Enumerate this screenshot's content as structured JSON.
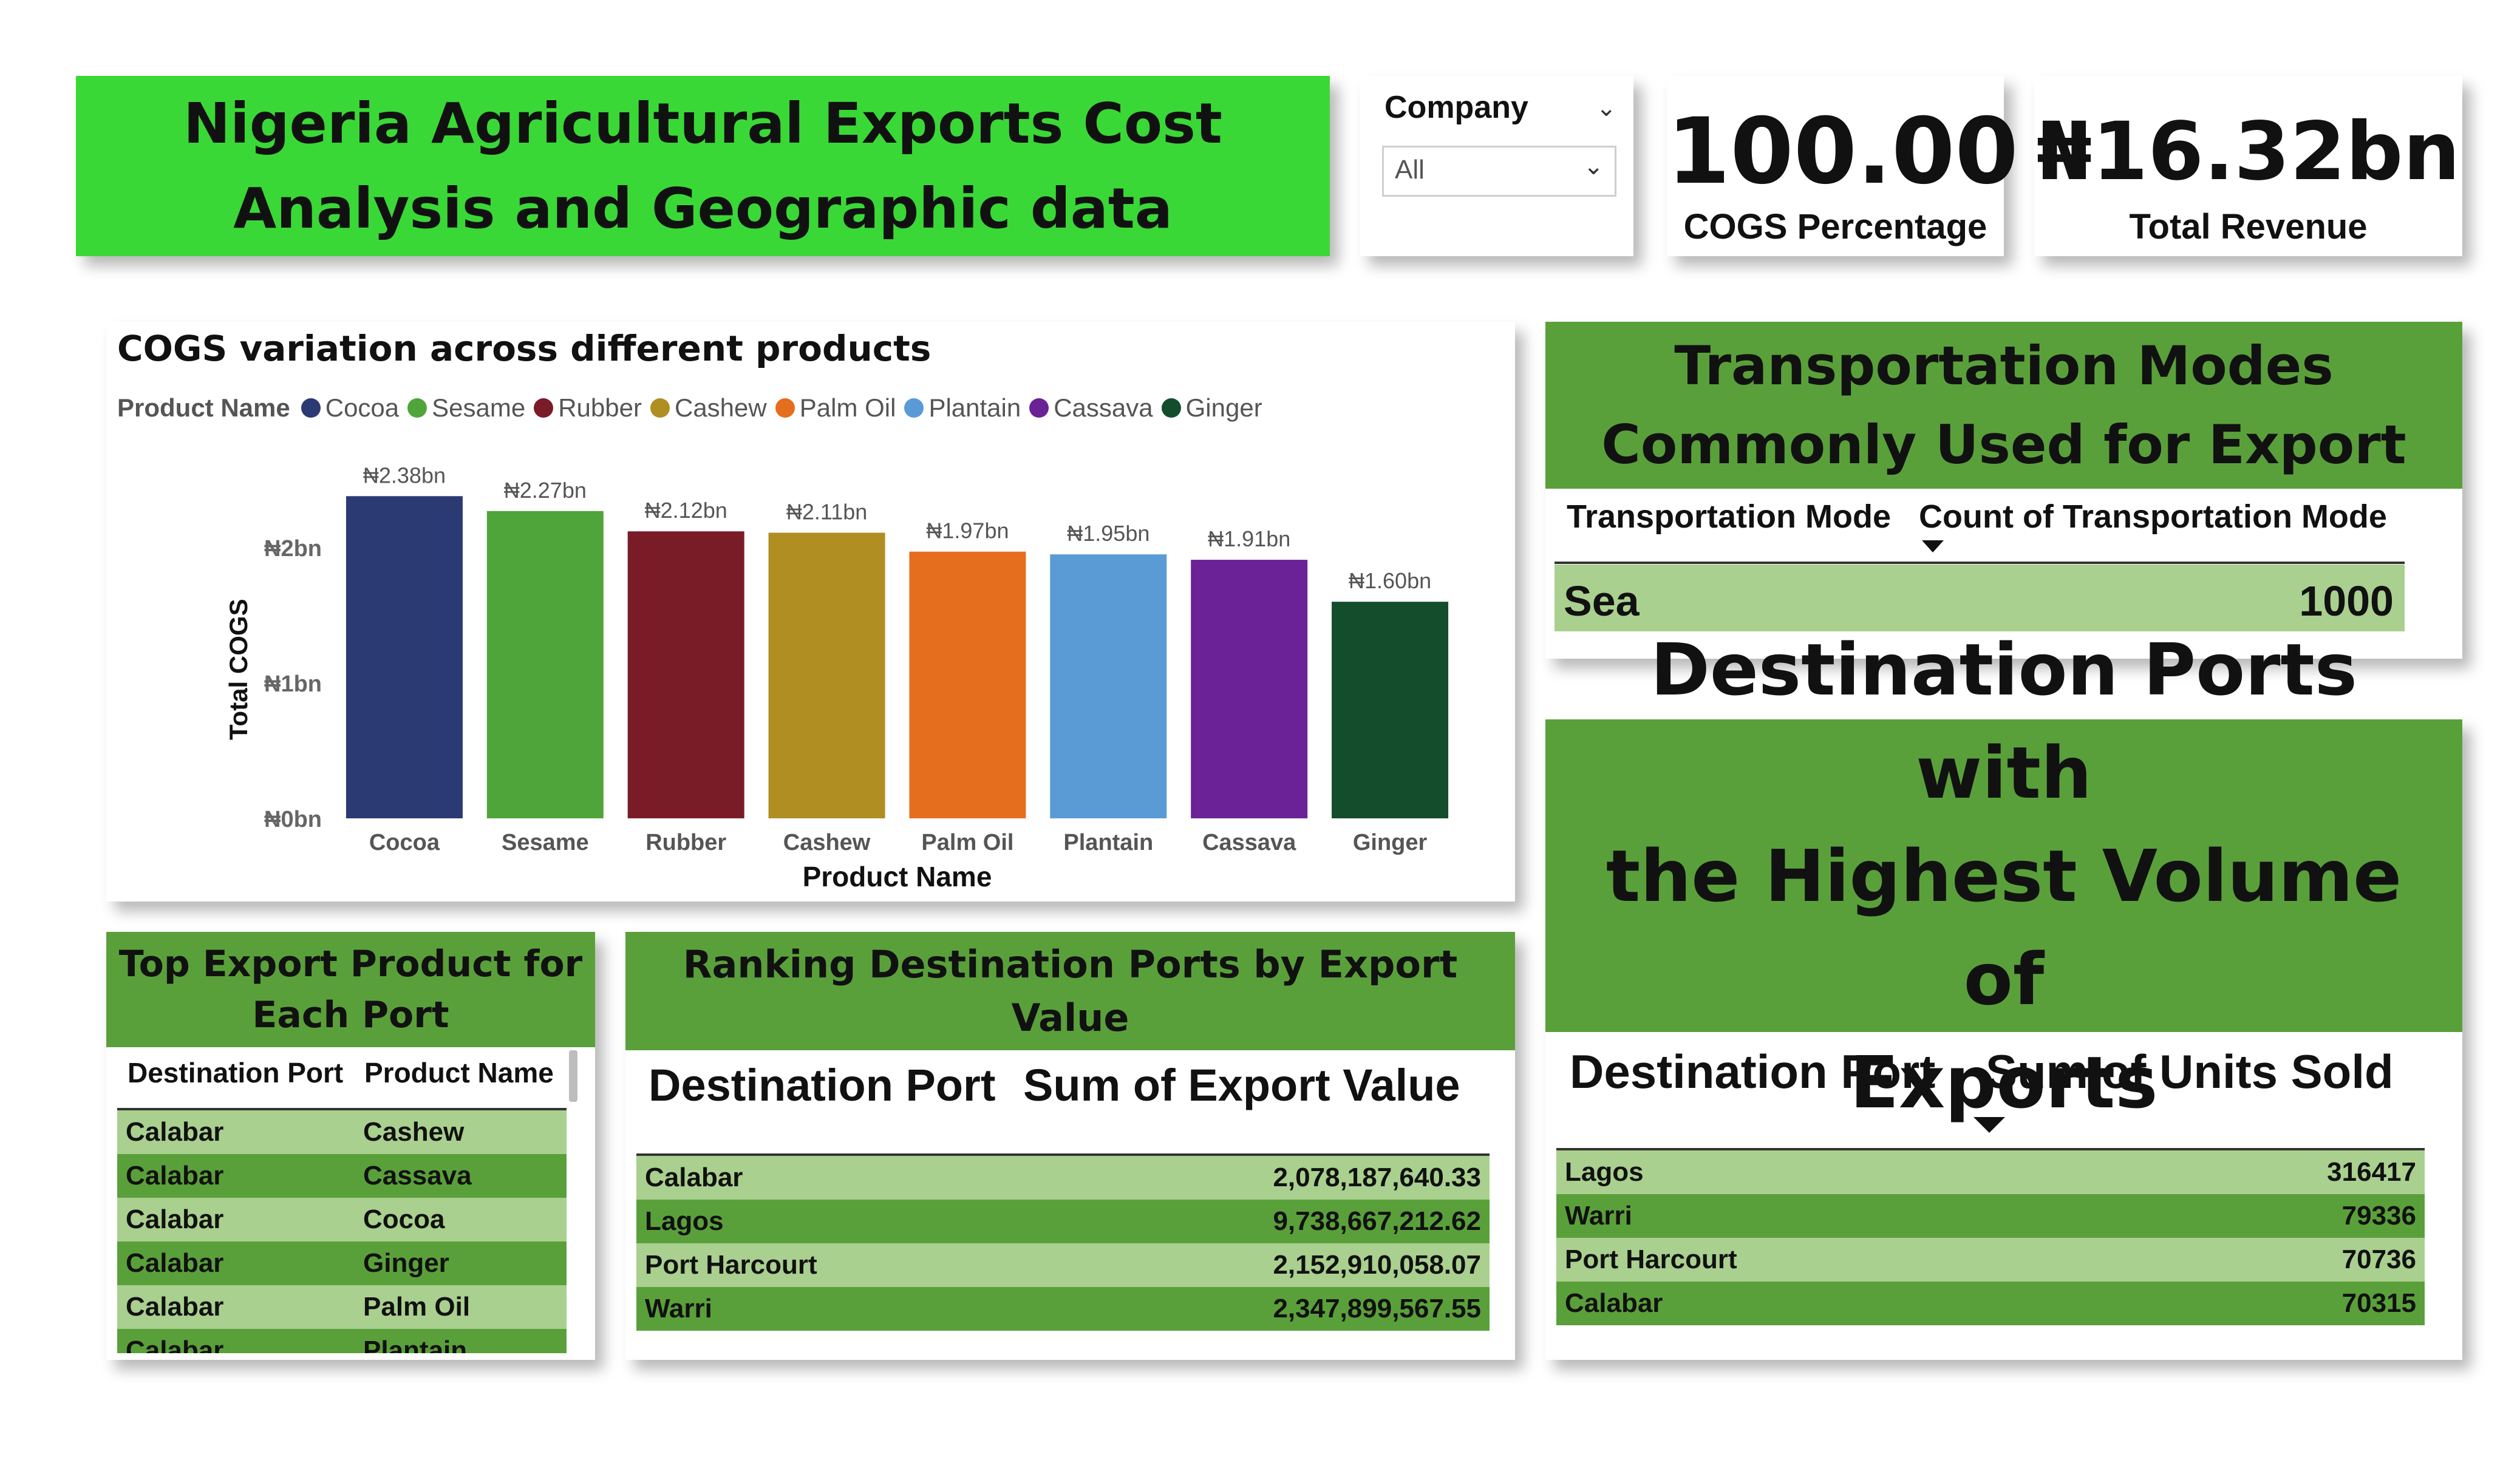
{
  "header": {
    "title_line1": "Nigeria Agricultural Exports Cost",
    "title_line2": "Analysis and Geographic data"
  },
  "slicer": {
    "label": "Company",
    "value": "All"
  },
  "kpis": {
    "cogs_value": "100.00",
    "cogs_label": "COGS Percentage",
    "revenue_value": "₦16.32bn",
    "revenue_label": "Total Revenue"
  },
  "chart_data": {
    "type": "bar",
    "title": "COGS variation across different products",
    "legend_title": "Product Name",
    "categories": [
      "Cocoa",
      "Sesame",
      "Rubber",
      "Cashew",
      "Palm Oil",
      "Plantain",
      "Cassava",
      "Ginger"
    ],
    "values": [
      2.38,
      2.27,
      2.12,
      2.11,
      1.97,
      1.95,
      1.91,
      1.6
    ],
    "data_labels": [
      "₦2.38bn",
      "₦2.27bn",
      "₦2.12bn",
      "₦2.11bn",
      "₦1.97bn",
      "₦1.95bn",
      "₦1.91bn",
      "₦1.60bn"
    ],
    "colors": [
      "#2b3a73",
      "#4fa53a",
      "#7a1c28",
      "#b08e22",
      "#e56e1e",
      "#5b9bd5",
      "#6a2296",
      "#134d2c"
    ],
    "xlabel": "Product Name",
    "ylabel": "Total COGS",
    "yticks": [
      0,
      1,
      2
    ],
    "ytick_labels": [
      "₦0bn",
      "₦1bn",
      "₦2bn"
    ],
    "ylim": [
      0,
      2.5
    ],
    "value_unit": "₦bn",
    "grid": false,
    "legend_position": "top-left"
  },
  "transport": {
    "title_line1": "Transportation Modes",
    "title_line2": "Commonly Used for Export",
    "col1": "Transportation Mode",
    "col2": "Count of Transportation Mode",
    "rows": [
      {
        "mode": "Sea",
        "count": "1000"
      }
    ]
  },
  "destination_volume": {
    "title_line1": "Destination Ports with",
    "title_line2": "the Highest Volume of",
    "title_line3": "Exports",
    "col1": "Destination Port",
    "col2": "Sum of Units Sold",
    "rows": [
      {
        "port": "Lagos",
        "units": "316417"
      },
      {
        "port": "Warri",
        "units": "79336"
      },
      {
        "port": "Port Harcourt",
        "units": "70736"
      },
      {
        "port": "Calabar",
        "units": "70315"
      }
    ]
  },
  "top_export": {
    "title_line1": "Top Export Product for",
    "title_line2": "Each Port",
    "col1": "Destination Port",
    "col2": "Product Name",
    "rows": [
      {
        "port": "Calabar",
        "product": "Cashew"
      },
      {
        "port": "Calabar",
        "product": "Cassava"
      },
      {
        "port": "Calabar",
        "product": "Cocoa"
      },
      {
        "port": "Calabar",
        "product": "Ginger"
      },
      {
        "port": "Calabar",
        "product": "Palm Oil"
      },
      {
        "port": "Calabar",
        "product": "Plantain"
      }
    ]
  },
  "ranking": {
    "title_line1": "Ranking Destination Ports by Export",
    "title_line2": "Value",
    "col1": "Destination Port",
    "col2": "Sum of Export Value",
    "rows": [
      {
        "port": "Calabar",
        "value": "2,078,187,640.33"
      },
      {
        "port": "Lagos",
        "value": "9,738,667,212.62"
      },
      {
        "port": "Port Harcourt",
        "value": "2,152,910,058.07"
      },
      {
        "port": "Warri",
        "value": "2,347,899,567.55"
      }
    ]
  }
}
